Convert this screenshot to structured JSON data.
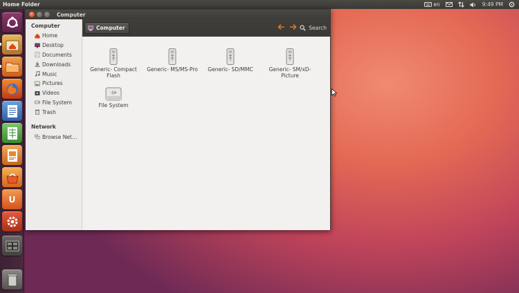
{
  "top_panel": {
    "title": "Home Folder",
    "keyboard_layout": "en",
    "time": "9:49 PM"
  },
  "launcher": {
    "items": [
      {
        "name": "dash-home",
        "icon": "ubuntu-logo-icon"
      },
      {
        "name": "home-folder",
        "icon": "home-folder-icon",
        "running": true
      },
      {
        "name": "files",
        "icon": "folder-icon",
        "running": true
      },
      {
        "name": "firefox",
        "icon": "firefox-icon"
      },
      {
        "name": "libreoffice-writer",
        "icon": "writer-icon"
      },
      {
        "name": "libreoffice-calc",
        "icon": "calc-icon"
      },
      {
        "name": "libreoffice-impress",
        "icon": "impress-icon"
      },
      {
        "name": "software-center",
        "icon": "software-center-icon"
      },
      {
        "name": "ubuntu-one",
        "icon": "ubuntu-one-icon",
        "label": "U"
      },
      {
        "name": "system-settings",
        "icon": "settings-gear-icon"
      },
      {
        "name": "workspace-switcher",
        "icon": "workspace-icon"
      },
      {
        "name": "trash",
        "icon": "trash-icon"
      }
    ]
  },
  "window": {
    "title": "Computer",
    "breadcrumb": "Computer",
    "search_label": "Search"
  },
  "sidebar": {
    "computer_header": "Computer",
    "computer_items": [
      {
        "label": "Home",
        "icon": "home-icon"
      },
      {
        "label": "Desktop",
        "icon": "desktop-icon"
      },
      {
        "label": "Documents",
        "icon": "documents-icon"
      },
      {
        "label": "Downloads",
        "icon": "downloads-icon"
      },
      {
        "label": "Music",
        "icon": "music-icon"
      },
      {
        "label": "Pictures",
        "icon": "pictures-icon"
      },
      {
        "label": "Videos",
        "icon": "videos-icon"
      },
      {
        "label": "File System",
        "icon": "file-system-icon"
      },
      {
        "label": "Trash",
        "icon": "trash-icon"
      }
    ],
    "network_header": "Network",
    "network_items": [
      {
        "label": "Browse Net…",
        "icon": "network-icon"
      }
    ]
  },
  "files": [
    {
      "line1": "Generic- Compact",
      "line2": "Flash",
      "icon": "usb-drive-icon"
    },
    {
      "line1": "Generic- MS/MS-Pro",
      "line2": "",
      "icon": "usb-drive-icon"
    },
    {
      "line1": "Generic- SD/MMC",
      "line2": "",
      "icon": "usb-drive-icon"
    },
    {
      "line1": "Generic- SM/xD-",
      "line2": "Picture",
      "icon": "usb-drive-icon"
    },
    {
      "line1": "File System",
      "line2": "",
      "icon": "hard-drive-icon"
    }
  ],
  "colors": {
    "accent": "#dd4814",
    "panel": "#3c3b37",
    "launcher": "#3b2233"
  }
}
